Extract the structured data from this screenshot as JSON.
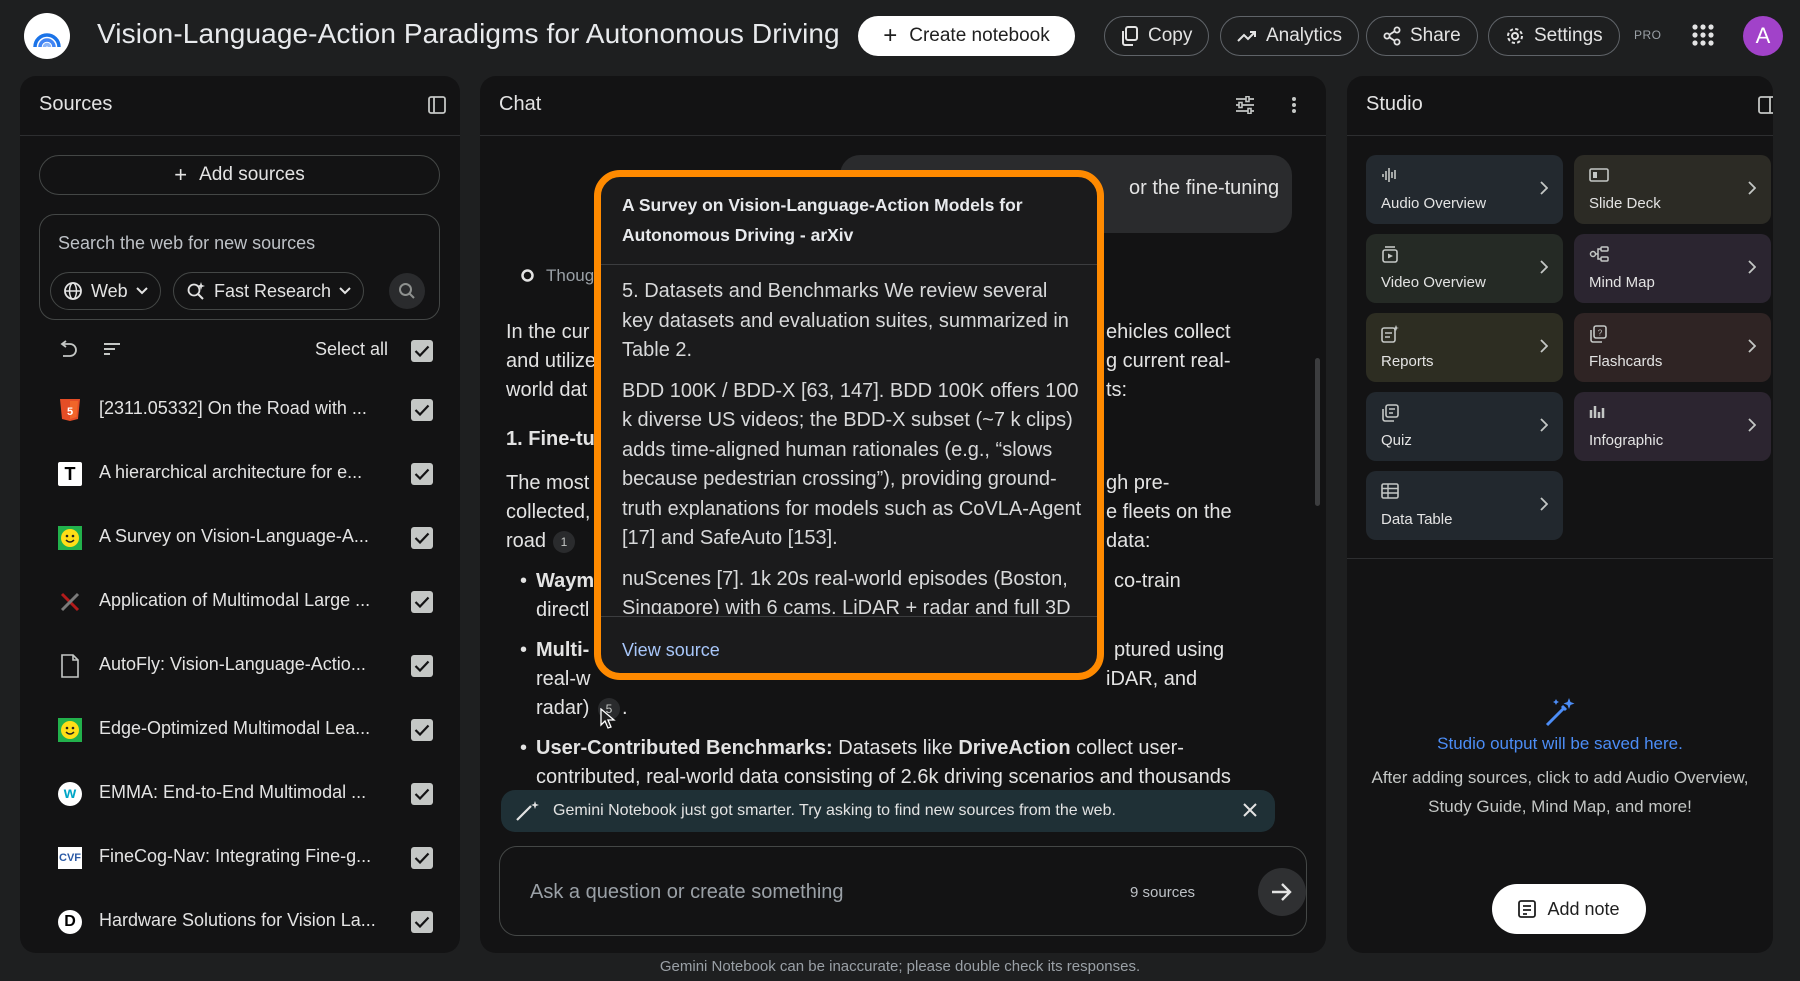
{
  "header": {
    "title": "Vision-Language-Action Paradigms for Autonomous Driving",
    "create_notebook": "Create notebook",
    "copy": "Copy",
    "analytics": "Analytics",
    "share": "Share",
    "settings": "Settings",
    "pro_badge": "PRO",
    "avatar_initial": "A"
  },
  "sources": {
    "title": "Sources",
    "add_sources": "Add sources",
    "search_placeholder": "Search the web for new sources",
    "web_chip": "Web",
    "research_chip": "Fast Research",
    "select_all": "Select all",
    "items": [
      {
        "label": "[2311.05332] On the Road with ...",
        "icon": "html5-icon"
      },
      {
        "label": "A hierarchical architecture for e...",
        "icon": "letter-t-icon"
      },
      {
        "label": "A Survey on Vision-Language-A...",
        "icon": "smiley-icon"
      },
      {
        "label": "Application of Multimodal Large ...",
        "icon": "x-logo-icon"
      },
      {
        "label": "AutoFly: Vision-Language-Actio...",
        "icon": "document-icon"
      },
      {
        "label": "Edge-Optimized Multimodal Lea...",
        "icon": "smiley-icon"
      },
      {
        "label": "EMMA: End-to-End Multimodal ...",
        "icon": "w-logo-icon"
      },
      {
        "label": "FineCog-Nav: Integrating Fine-g...",
        "icon": "cvf-icon"
      },
      {
        "label": "Hardware Solutions for Vision La...",
        "icon": "letter-d-icon"
      }
    ]
  },
  "chat": {
    "title": "Chat",
    "user_msg_visible": "or the fine-tuning",
    "thought_label": "Thoug",
    "para1": [
      "In the cur",
      "ehicles collect",
      "and utilize",
      "g current real-",
      "world dat",
      "ts:"
    ],
    "heading1_visible": "1. Fine-tu",
    "para2": [
      "The most",
      "gh pre-",
      "collected,",
      "e fleets on the",
      "road",
      "data:"
    ],
    "citation_1": "1",
    "citation_5": "5",
    "bullet1_bold": "Waym",
    "bullet1_rest": "co-train",
    "bullet1_line2": "directl",
    "bullet2_bold": "Multi-",
    "bullet2_rest": "ptured using",
    "bullet2_line2": "real-w",
    "bullet2_line2_right": "iDAR, and",
    "bullet2_line3": "radar)",
    "bullet3_bold": "User-Contributed Benchmarks:",
    "bullet3_text_a": " Datasets like ",
    "bullet3_bold2": "DriveAction",
    "bullet3_text_b": " collect user-",
    "bullet3_line2": "contributed, real-world data consisting of 2.6k driving scenarios and thousands",
    "notice": "Gemini Notebook just got smarter. Try asking to find new sources from the web.",
    "input_placeholder": "Ask a question or create something",
    "source_count": "9 sources"
  },
  "popover": {
    "title": "A Survey on Vision-Language-Action Models for Autonomous Driving - arXiv",
    "paragraphs": [
      "5. Datasets and Benchmarks We review several key datasets and evaluation suites, summarized in Table 2.",
      "BDD 100K / BDD-X [63, 147]. BDD 100K offers 100 k diverse US videos; the BDD-X subset (~7 k clips) adds time-aligned human rationales (e.g., “slows because pedestrian crossing”), providing ground-truth explanations for models such as CoVLA-Agent [17] and SafeAuto [153].",
      "nuScenes [7]. 1k 20s real-world episodes (Boston, Singapore) with 6 cams, LiDAR + radar and full 3D"
    ],
    "view_source": "View source"
  },
  "studio": {
    "title": "Studio",
    "tiles": [
      {
        "label": "Audio Overview",
        "icon": "audio-waveform-icon",
        "color": "#23292f"
      },
      {
        "label": "Slide Deck",
        "icon": "slides-icon",
        "color": "#2c2b25"
      },
      {
        "label": "Video Overview",
        "icon": "video-icon",
        "color": "#252a25"
      },
      {
        "label": "Mind Map",
        "icon": "mind-map-icon",
        "color": "#2b2530"
      },
      {
        "label": "Reports",
        "icon": "reports-icon",
        "color": "#2d2d22"
      },
      {
        "label": "Flashcards",
        "icon": "flashcards-icon",
        "color": "#2f2424"
      },
      {
        "label": "Quiz",
        "icon": "quiz-icon",
        "color": "#22282e"
      },
      {
        "label": "Infographic",
        "icon": "infographic-icon",
        "color": "#2c2530"
      },
      {
        "label": "Data Table",
        "icon": "table-icon",
        "color": "#22282e"
      }
    ],
    "empty_title": "Studio output will be saved here.",
    "empty_desc_line1": "After adding sources, click to add Audio Overview,",
    "empty_desc_line2": "Study Guide, Mind Map, and more!",
    "add_note": "Add note"
  },
  "footer": "Gemini Notebook can be inaccurate; please double check its responses.",
  "colors": {
    "accent_orange": "#ff8a00",
    "link_blue": "#a8c7fa",
    "studio_blue": "#4c8df6",
    "avatar_purple": "#a142c9"
  }
}
